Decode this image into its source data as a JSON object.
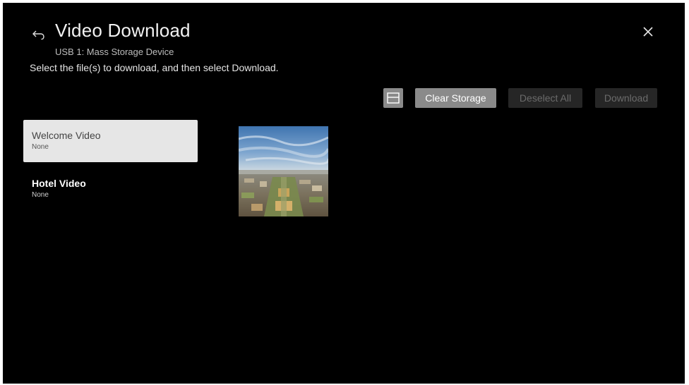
{
  "header": {
    "title": "Video Download",
    "subtitle": "USB 1: Mass Storage Device",
    "instruction": "Select the file(s) to download, and then select Download.",
    "back_icon": "back-arrow-icon",
    "close_icon": "close-icon"
  },
  "toolbar": {
    "view_toggle_icon": "view-mode-icon",
    "clear_storage_label": "Clear Storage",
    "deselect_all_label": "Deselect All",
    "download_label": "Download"
  },
  "file_list": [
    {
      "title": "Welcome Video",
      "subtitle": "None",
      "selected": true
    },
    {
      "title": "Hotel Video",
      "subtitle": "None",
      "selected": false
    }
  ],
  "colors": {
    "background": "#000000",
    "active_button": "#8a8a8a",
    "disabled_button": "#262626",
    "disabled_text": "#6b6b6b",
    "selected_item": "#e6e6e6"
  }
}
